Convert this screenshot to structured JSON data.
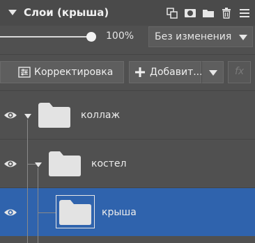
{
  "header": {
    "title": "Слои (крыша)",
    "icons": [
      "duplicate-layer-icon",
      "mask-icon",
      "folder-icon",
      "trash-icon",
      "menu-icon"
    ]
  },
  "opacity": {
    "value_label": "100%",
    "value": 1.0
  },
  "blend_mode": {
    "selected": "Без изменения"
  },
  "buttons": {
    "adjustment": "Корректировка",
    "add": "Добавит...",
    "fx": "fx"
  },
  "layers": [
    {
      "name": "коллаж",
      "type": "folder",
      "depth": 0,
      "visible": true,
      "expanded": true,
      "selected": false
    },
    {
      "name": "костел",
      "type": "folder",
      "depth": 1,
      "visible": true,
      "expanded": true,
      "selected": false
    },
    {
      "name": "крыша",
      "type": "folder",
      "depth": 2,
      "visible": true,
      "expanded": false,
      "selected": true
    }
  ],
  "colors": {
    "panel_bg": "#505050",
    "selection": "#2f63ad",
    "text": "#e6e6e6"
  }
}
